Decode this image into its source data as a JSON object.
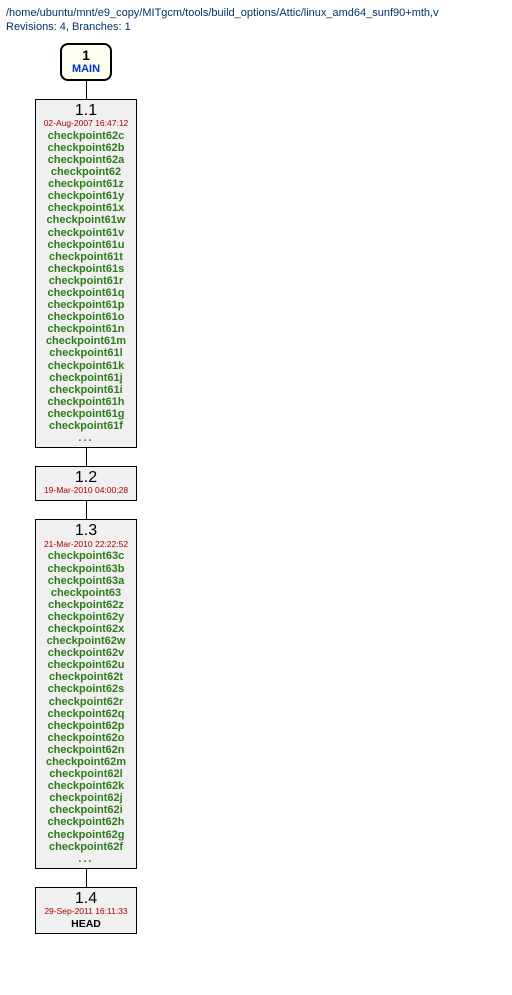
{
  "header": {
    "path": "/home/ubuntu/mnt/e9_copy/MITgcm/tools/build_options/Attic/linux_amd64_sunf90+mth,v",
    "stats": "Revisions: 4, Branches: 1"
  },
  "branch": {
    "number": "1",
    "name": "MAIN"
  },
  "revisions": [
    {
      "id": "r11",
      "number": "1.1",
      "date": "02-Aug-2007 16:47:12",
      "tags": [
        "checkpoint62c",
        "checkpoint62b",
        "checkpoint62a",
        "checkpoint62",
        "checkpoint61z",
        "checkpoint61y",
        "checkpoint61x",
        "checkpoint61w",
        "checkpoint61v",
        "checkpoint61u",
        "checkpoint61t",
        "checkpoint61s",
        "checkpoint61r",
        "checkpoint61q",
        "checkpoint61p",
        "checkpoint61o",
        "checkpoint61n",
        "checkpoint61m",
        "checkpoint61l",
        "checkpoint61k",
        "checkpoint61j",
        "checkpoint61i",
        "checkpoint61h",
        "checkpoint61g",
        "checkpoint61f"
      ],
      "more": "..."
    },
    {
      "id": "r12",
      "number": "1.2",
      "date": "19-Mar-2010 04:00:28",
      "tags": [],
      "more": ""
    },
    {
      "id": "r13",
      "number": "1.3",
      "date": "21-Mar-2010 22:22:52",
      "tags": [
        "checkpoint63c",
        "checkpoint63b",
        "checkpoint63a",
        "checkpoint63",
        "checkpoint62z",
        "checkpoint62y",
        "checkpoint62x",
        "checkpoint62w",
        "checkpoint62v",
        "checkpoint62u",
        "checkpoint62t",
        "checkpoint62s",
        "checkpoint62r",
        "checkpoint62q",
        "checkpoint62p",
        "checkpoint62o",
        "checkpoint62n",
        "checkpoint62m",
        "checkpoint62l",
        "checkpoint62k",
        "checkpoint62j",
        "checkpoint62i",
        "checkpoint62h",
        "checkpoint62g",
        "checkpoint62f"
      ],
      "more": "..."
    },
    {
      "id": "r14",
      "number": "1.4",
      "date": "29-Sep-2011 16:11:33",
      "head": "HEAD",
      "tags": [],
      "more": ""
    }
  ]
}
